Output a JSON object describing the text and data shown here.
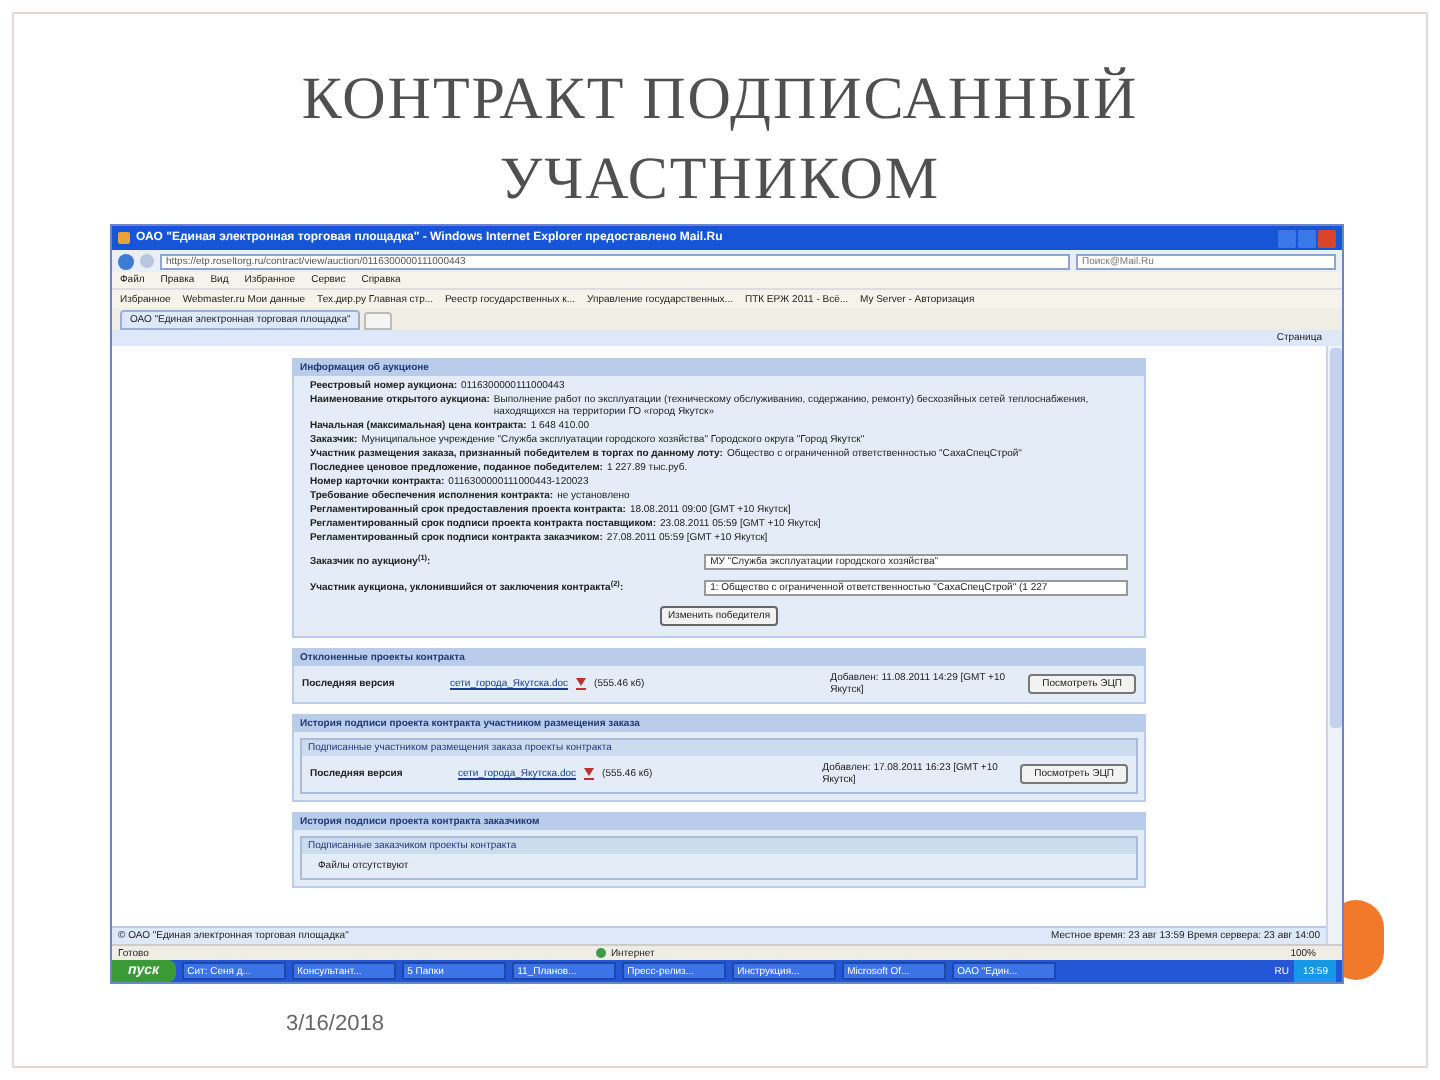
{
  "slide": {
    "title": "КОНТРАКТ ПОДПИСАННЫЙ УЧАСТНИКОМ",
    "date": "3/16/2018"
  },
  "browser": {
    "window_title": "ОАО \"Единая электронная торговая площадка\" - Windows Internet Explorer предоставлено Mail.Ru",
    "address": {
      "url": "https://etp.roseltorg.ru/contract/view/auction/0116300000111000443"
    },
    "search": {
      "placeholder": "Поиск@Mail.Ru"
    },
    "menu": [
      "Файл",
      "Правка",
      "Вид",
      "Избранное",
      "Сервис",
      "Справка"
    ],
    "favorites": [
      "Избранное",
      "Webmaster.ru Мои данные",
      "Тех.дир.ру Главная стр...",
      "Реестр государственных к...",
      "Управление государственных...",
      "ПТК ЕРЖ 2011 - Всё...",
      "My Server - Авторизация"
    ],
    "tabs": [
      {
        "label": "ОАО \"Единая электронная торговая площадка\"",
        "selected": true
      }
    ],
    "page_tools": [
      "Страница"
    ],
    "page": {
      "info": {
        "heading": "Информация об аукционе",
        "fields": [
          {
            "label": "Реестровый номер аукциона:",
            "value": "0116300000111000443"
          },
          {
            "label": "Наименование открытого аукциона:",
            "value": "Выполнение работ по эксплуатации (техническому обслуживанию, содержанию, ремонту) бесхозяйных сетей теплоснабжения, находящихся на территории ГО «город Якутск»"
          },
          {
            "label": "Начальная (максимальная) цена контракта:",
            "value": "1 648 410.00"
          },
          {
            "label": "Заказчик:",
            "value": "Муниципальное учреждение \"Служба эксплуатации городского хозяйства\" Городского округа \"Город Якутск\""
          },
          {
            "label": "Участник размещения заказа, признанный победителем в торгах по данному лоту:",
            "value": "Общество с ограниченной ответственностью \"СахаСпецСтрой\""
          },
          {
            "label": "Последнее ценовое предложение, поданное победителем:",
            "value": "1 227.89 тыс.руб."
          },
          {
            "label": "Номер карточки контракта:",
            "value": "0116300000111000443-120023"
          },
          {
            "label": "Требование обеспечения исполнения контракта:",
            "value": "не установлено"
          },
          {
            "label": "Регламентированный срок предоставления проекта контракта:",
            "value": "18.08.2011 09:00 [GMT +10 Якутск]"
          },
          {
            "label": "Регламентированный срок подписи проекта контракта поставщиком:",
            "value": "23.08.2011 05:59 [GMT +10 Якутск]"
          },
          {
            "label": "Регламентированный срок подписи контракта заказчиком:",
            "value": "27.08.2011 05:59 [GMT +10 Якутск]"
          }
        ],
        "selects": [
          {
            "label": "Заказчик по аукциону$^{(1)}$:",
            "value": "МУ \"Служба эксплуатации городского хозяйства\""
          },
          {
            "label": "Участник аукциона, уклонившийся от заключения контракта$^{(2)}$:",
            "value": "1: Общество с ограниченной ответственностью \"СахаСпецСтрой\" (1 227"
          }
        ],
        "button": "Изменить победителя"
      },
      "sections": [
        {
          "kind": "files",
          "heading": "Отклоненные проекты контракта",
          "rows": [
            {
              "label": "Последняя версия",
              "file": "сети_города_Якутска.doc",
              "size": "(555.46 кб)",
              "added": "Добавлен: 11.08.2011 14:29 [GMT +10 Якутск]",
              "button": "Посмотреть ЭЦП"
            }
          ]
        },
        {
          "kind": "files",
          "heading": "История подписи проекта контракта участником размещения заказа",
          "subheading": "Подписанные участником размещения заказа проекты контракта",
          "rows": [
            {
              "label": "Последняя версия",
              "file": "сети_города_Якутска.doc",
              "size": "(555.46 кб)",
              "added": "Добавлен: 17.08.2011 16:23 [GMT +10 Якутск]",
              "button": "Посмотреть ЭЦП"
            }
          ]
        },
        {
          "kind": "empty",
          "heading": "История подписи проекта контракта заказчиком",
          "subheading": "Подписанные заказчиком проекты контракта",
          "empty_text": "Файлы отсутствуют"
        }
      ],
      "footer": {
        "copyright": "© ОАО \"Единая электронная торговая площадка\"",
        "time": "Местное время: 23 авг 13:59 Время сервера: 23 авг 14:00"
      }
    },
    "status_bar": {
      "text": "Готово",
      "zone": "Интернет",
      "zoom": "100%"
    },
    "taskbar": {
      "start": "пуск",
      "items": [
        "Сит: Сеня д...",
        "Консультант...",
        "5 Папки",
        "11_Планов...",
        "Пресс-релиз...",
        "Инструкция...",
        "Microsoft Of...",
        "ОАО \"Един..."
      ],
      "lang": "RU",
      "clock": "13:59"
    }
  }
}
